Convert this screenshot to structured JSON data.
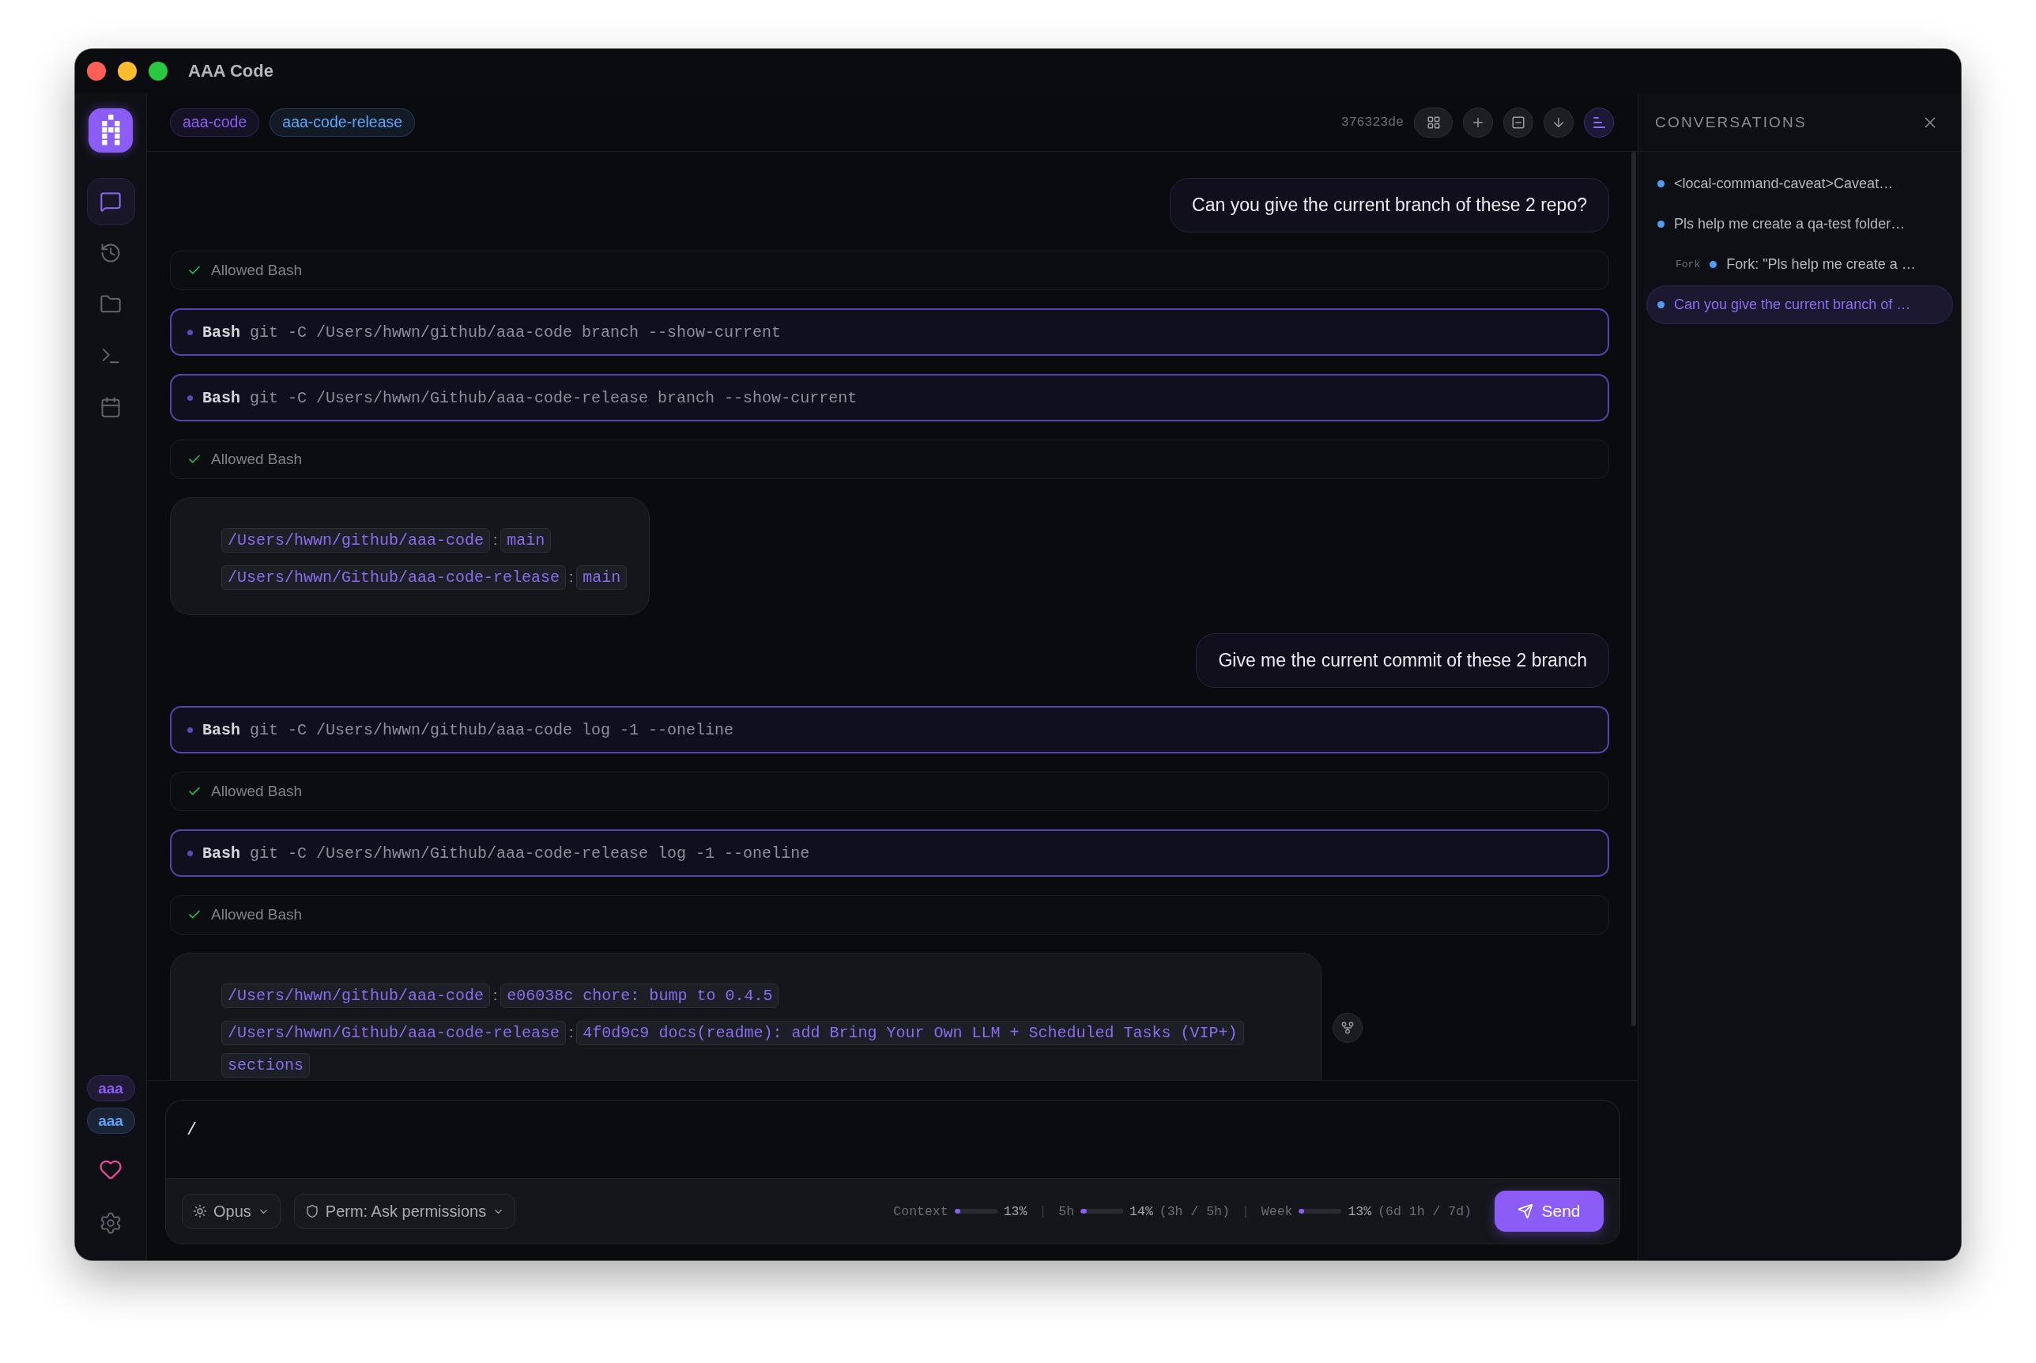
{
  "window": {
    "title": "AAA Code"
  },
  "sidebar": {
    "items": [
      {
        "selected": true
      },
      {
        "selected": false
      },
      {
        "selected": false
      },
      {
        "selected": false
      },
      {
        "selected": false
      }
    ],
    "badges": [
      {
        "label": "aaa",
        "color": "#8b5cf6"
      },
      {
        "label": "aaa",
        "color": "#60a5fa"
      }
    ]
  },
  "topbar": {
    "tags": [
      {
        "label": "aaa-code",
        "color": "#8b5cf6"
      },
      {
        "label": "aaa-code-release",
        "color": "#60a5fa"
      }
    ],
    "commit": "376323de",
    "buttons": [
      {
        "on": false
      },
      {
        "on": false
      },
      {
        "on": false
      },
      {
        "on": false
      },
      {
        "on": true
      }
    ]
  },
  "messages": [
    {
      "kind": "user",
      "text": "Can you give the current branch of these 2 repo?"
    },
    {
      "kind": "permission",
      "text": "Allowed Bash"
    },
    {
      "kind": "tool",
      "tool": "Bash",
      "command": "git -C /Users/hwwn/github/aaa-code branch --show-current"
    },
    {
      "kind": "tool",
      "tool": "Bash",
      "command": "git -C /Users/hwwn/Github/aaa-code-release branch --show-current"
    },
    {
      "kind": "permission",
      "text": "Allowed Bash"
    },
    {
      "kind": "result",
      "action_button": false,
      "lines": [
        {
          "path": "/Users/hwwn/github/aaa-code",
          "separator": ":",
          "value": "main"
        },
        {
          "path": "/Users/hwwn/Github/aaa-code-release",
          "separator": ":",
          "value": "main"
        }
      ]
    },
    {
      "kind": "user",
      "text": "Give me the current commit of these 2 branch"
    },
    {
      "kind": "tool",
      "tool": "Bash",
      "command": "git -C /Users/hwwn/github/aaa-code log -1 --oneline"
    },
    {
      "kind": "permission",
      "text": "Allowed Bash"
    },
    {
      "kind": "tool",
      "tool": "Bash",
      "command": "git -C /Users/hwwn/Github/aaa-code-release log -1 --oneline"
    },
    {
      "kind": "permission",
      "text": "Allowed Bash"
    },
    {
      "kind": "result",
      "action_button": true,
      "lines": [
        {
          "path": "/Users/hwwn/github/aaa-code",
          "separator": ":",
          "value": "e06038c chore: bump to 0.4.5"
        },
        {
          "path": "/Users/hwwn/Github/aaa-code-release",
          "separator": ":",
          "value": "4f0d9c9 docs(readme): add Bring Your Own LLM + Scheduled Tasks (VIP+) sections"
        }
      ]
    }
  ],
  "composer": {
    "value": "/",
    "model": "Opus",
    "permission": "Perm: Ask permissions",
    "meters": [
      {
        "label": "Context",
        "level": 0.13,
        "reading": "13%"
      },
      {
        "separator": "|",
        "label": "5h",
        "level": 0.14,
        "reading": "14%",
        "detail": "(3h / 5h)"
      },
      {
        "separator": "|",
        "label": "Week",
        "level": 0.13,
        "reading": "13%",
        "detail": "(6d 1h / 7d)"
      }
    ],
    "send": "Send"
  },
  "conversations": {
    "title": "CONVERSATIONS",
    "items": [
      {
        "title": "<local-command-caveat>Caveat…",
        "selected": false
      },
      {
        "title": "Pls help me create a qa-test folder…",
        "selected": false,
        "children": [
          {
            "tag": "Fork",
            "title": "Fork: \"Pls help me create a …",
            "selected": false
          }
        ]
      },
      {
        "title": "Can you give the current branch of …",
        "selected": true
      }
    ]
  }
}
